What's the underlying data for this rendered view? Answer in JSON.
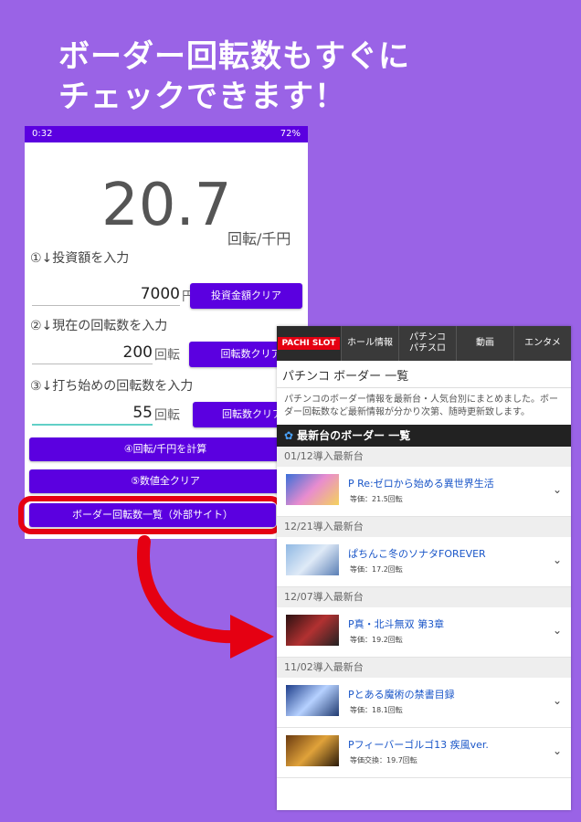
{
  "headline": {
    "line1": "ボーダー回転数もすぐに",
    "line2": "チェックできます！"
  },
  "phone": {
    "status_time": "0:32",
    "status_right": "72%",
    "result_value": "20.7",
    "result_unit": "回転/千円",
    "step1_label": "①↓投資額を入力",
    "step1_value": "7000",
    "step1_unit": "円",
    "step1_button": "投資金額クリア",
    "step2_label": "②↓現在の回転数を入力",
    "step2_value": "200",
    "step2_unit": "回転",
    "step2_button": "回転数クリア",
    "step3_label": "③↓打ち始めの回転数を入力",
    "step3_value": "55",
    "step3_unit": "回転",
    "step3_button": "回転数クリア",
    "calc_button": "④回転/千円を計算",
    "clear_all_button": "⑤数値全クリア",
    "external_button": "ボーダー回転数一覧（外部サイト）"
  },
  "site": {
    "logo": "PACHI SLOT",
    "nav": [
      "ホール情報",
      "パチンコ\nパチスロ",
      "動画",
      "エンタメ"
    ],
    "title": "パチンコ ボーダー 一覧",
    "description": "パチンコのボーダー情報を最新台・人気台別にまとめました。ボーダー回転数など最新情報が分かり次第、随時更新致します。",
    "section_title": "最新台のボーダー 一覧",
    "groups": [
      {
        "date": "01/12導入最新台",
        "items": [
          {
            "name": "P Re:ゼロから始める異世界生活",
            "sub": "等価：21.5回転"
          }
        ]
      },
      {
        "date": "12/21導入最新台",
        "items": [
          {
            "name": "ぱちんこ冬のソナタFOREVER",
            "sub": "等価：17.2回転"
          }
        ]
      },
      {
        "date": "12/07導入最新台",
        "items": [
          {
            "name": "P真・北斗無双 第3章",
            "sub": "等価：19.2回転"
          }
        ]
      },
      {
        "date": "11/02導入最新台",
        "items": [
          {
            "name": "Pとある魔術の禁書目録",
            "sub": "等価：18.1回転"
          },
          {
            "name": "Pフィーバーゴルゴ13 疾風ver.",
            "sub": "等価交換：19.7回転"
          }
        ]
      }
    ]
  },
  "colors": {
    "background": "#9a63e6",
    "accent": "#5b00e0",
    "highlight": "#e50012"
  }
}
